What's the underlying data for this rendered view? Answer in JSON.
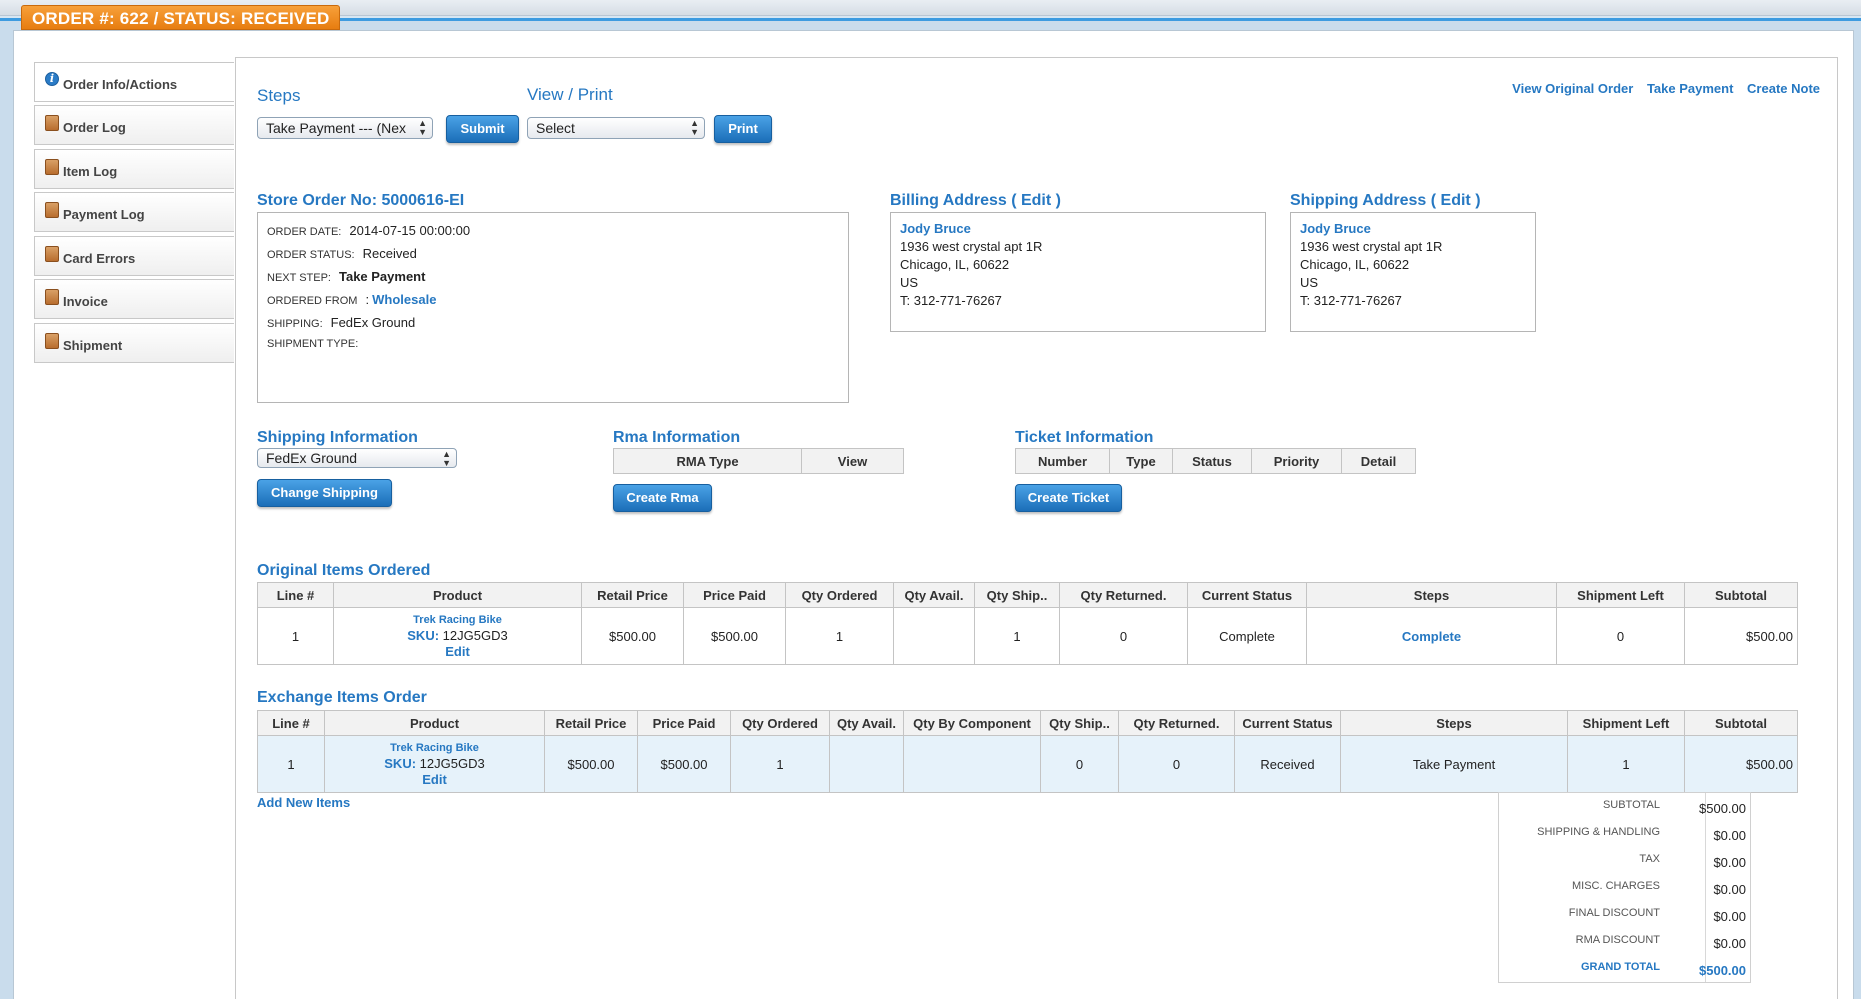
{
  "order_tab": "ORDER #: 622 / STATUS: RECEIVED",
  "sidebar": {
    "items": [
      {
        "label": "Order Info/Actions",
        "icon": "info-icon"
      },
      {
        "label": "Order Log",
        "icon": "book-icon"
      },
      {
        "label": "Item Log",
        "icon": "book-icon"
      },
      {
        "label": "Payment Log",
        "icon": "book-icon"
      },
      {
        "label": "Card Errors",
        "icon": "book-icon"
      },
      {
        "label": "Invoice",
        "icon": "book-icon"
      },
      {
        "label": "Shipment",
        "icon": "book-icon"
      }
    ]
  },
  "steps": {
    "label": "Steps",
    "select_value": "Take Payment --- (Nex",
    "submit": "Submit"
  },
  "view_print": {
    "label": "View / Print",
    "select_value": "Select",
    "print": "Print"
  },
  "top_links": {
    "view_original": "View Original Order",
    "take_payment": "Take Payment",
    "create_note": "Create Note"
  },
  "store_order": {
    "title": "Store Order No: 5000616-EI",
    "order_date_label": "ORDER DATE:",
    "order_date": "2014-07-15 00:00:00",
    "order_status_label": "ORDER STATUS:",
    "order_status": "Received",
    "next_step_label": "NEXT STEP:",
    "next_step": "Take Payment",
    "ordered_from_label": "ORDERED FROM",
    "ordered_from_colon": ":",
    "ordered_from": "Wholesale",
    "shipping_label": "SHIPPING:",
    "shipping": "FedEx Ground",
    "shipment_type_label": "SHIPMENT TYPE:"
  },
  "billing": {
    "title": "Billing Address ( Edit )",
    "name": "Jody Bruce",
    "line1": "1936 west crystal apt 1R",
    "line2": "Chicago, IL, 60622",
    "country": "US",
    "phone": "T: 312-771-76267"
  },
  "shipping_address": {
    "title": "Shipping Address ( Edit )",
    "name": "Jody Bruce",
    "line1": "1936 west crystal apt 1R",
    "line2": "Chicago, IL, 60622",
    "country": "US",
    "phone": "T: 312-771-76267"
  },
  "shipping_info": {
    "title": "Shipping Information",
    "select_value": "FedEx Ground",
    "button": "Change Shipping"
  },
  "rma": {
    "title": "Rma Information",
    "columns": [
      "RMA Type",
      "View"
    ],
    "button": "Create Rma"
  },
  "ticket": {
    "title": "Ticket Information",
    "columns": [
      "Number",
      "Type",
      "Status",
      "Priority",
      "Detail"
    ],
    "button": "Create Ticket"
  },
  "original_items": {
    "title": "Original Items Ordered",
    "columns": [
      "Line #",
      "Product",
      "Retail Price",
      "Price Paid",
      "Qty Ordered",
      "Qty Avail.",
      "Qty Ship..",
      "Qty Returned.",
      "Current Status",
      "Steps",
      "Shipment Left",
      "Subtotal"
    ],
    "row": {
      "line": "1",
      "product_name": "Trek Racing Bike",
      "sku_label": "SKU:",
      "sku": "12JG5GD3",
      "edit": "Edit",
      "retail": "$500.00",
      "paid": "$500.00",
      "qty_ordered": "1",
      "qty_avail": "",
      "qty_ship": "1",
      "qty_returned": "0",
      "status": "Complete",
      "steps": "Complete",
      "shipment_left": "0",
      "subtotal": "$500.00"
    }
  },
  "exchange_items": {
    "title": "Exchange Items Order",
    "columns": [
      "Line #",
      "Product",
      "Retail Price",
      "Price Paid",
      "Qty Ordered",
      "Qty Avail.",
      "Qty By Component",
      "Qty Ship..",
      "Qty Returned.",
      "Current Status",
      "Steps",
      "Shipment Left",
      "Subtotal"
    ],
    "row": {
      "line": "1",
      "product_name": "Trek Racing Bike",
      "sku_label": "SKU:",
      "sku": "12JG5GD3",
      "edit": "Edit",
      "retail": "$500.00",
      "paid": "$500.00",
      "qty_ordered": "1",
      "qty_avail": "",
      "qty_component": "",
      "qty_ship": "0",
      "qty_returned": "0",
      "status": "Received",
      "steps": "Take Payment",
      "shipment_left": "1",
      "subtotal": "$500.00"
    },
    "add_new": "Add New Items"
  },
  "totals": [
    {
      "label": "SUBTOTAL",
      "value": "$500.00"
    },
    {
      "label": "SHIPPING & HANDLING",
      "value": "$0.00"
    },
    {
      "label": "TAX",
      "value": "$0.00"
    },
    {
      "label": "MISC. CHARGES",
      "value": "$0.00"
    },
    {
      "label": "FINAL DISCOUNT",
      "value": "$0.00"
    },
    {
      "label": "RMA DISCOUNT",
      "value": "$0.00"
    },
    {
      "label": "GRAND TOTAL",
      "value": "$500.00"
    }
  ],
  "colors": {
    "accent": "#2678c2",
    "order_tab": "#f08a1c",
    "exchange_row": "#e6f2fa"
  }
}
